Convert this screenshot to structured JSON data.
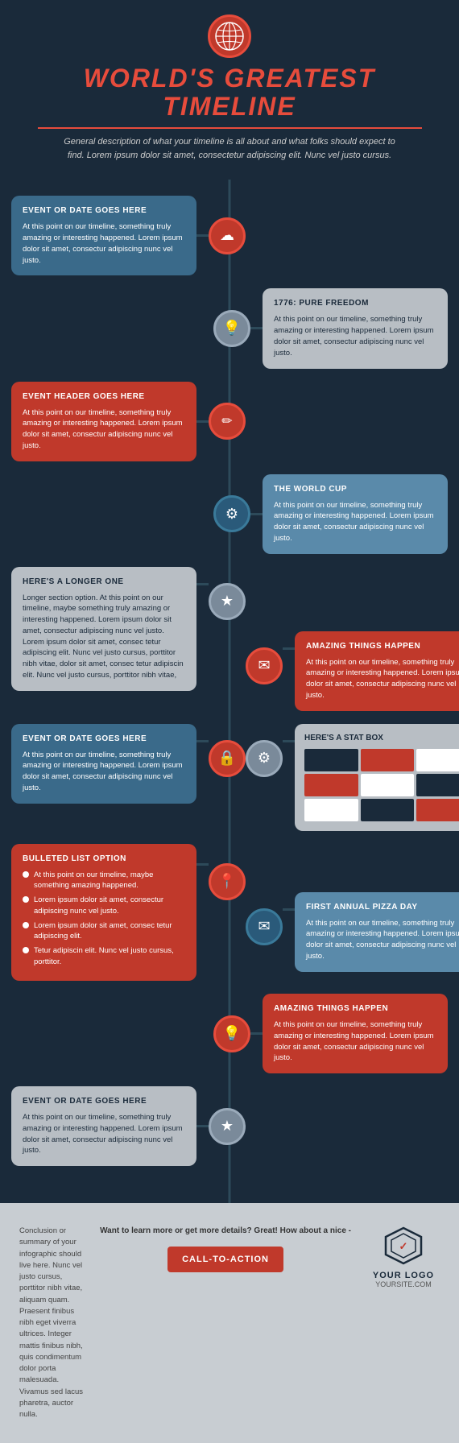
{
  "header": {
    "title": "WORLD'S GREATEST TIMELINE",
    "subtitle": "General description of what your timeline is all about and what folks should expect to find. Lorem ipsum dolor sit amet, consectetur adipiscing elit. Nunc vel justo cursus."
  },
  "timeline": {
    "events": [
      {
        "side": "left",
        "style": "blue",
        "icon": "☁",
        "icon_style": "red",
        "title": "EVENT OR DATE GOES HERE",
        "body": "At this point on our timeline, something truly amazing or interesting happened. Lorem ipsum dolor sit amet, consectur adipiscing nunc vel justo."
      },
      {
        "side": "right",
        "style": "gray",
        "icon": "💡",
        "icon_style": "gray",
        "title": "1776: PURE FREEDOM",
        "body": "At this point on our timeline, something truly amazing or interesting happened. Lorem ipsum dolor sit amet, consectur adipiscing nunc vel justo."
      },
      {
        "side": "left",
        "style": "red",
        "icon": "✏",
        "icon_style": "red",
        "title": "EVENT HEADER GOES HERE",
        "body": "At this point on our timeline, something truly amazing or interesting happened. Lorem ipsum dolor sit amet, consectur adipiscing nunc vel justo."
      },
      {
        "side": "right",
        "style": "light-blue",
        "icon": "⚙",
        "icon_style": "blue",
        "title": "THE WORLD CUP",
        "body": "At this point on our timeline, something truly amazing or interesting happened. Lorem ipsum dolor sit amet, consectur adipiscing nunc vel justo."
      },
      {
        "side": "left",
        "style": "gray",
        "icon": "★",
        "icon_style": "gray",
        "title": "HERE'S A LONGER ONE",
        "body": "Longer section option. At this point on our timeline, maybe something truly amazing or interesting happened. Lorem ipsum dolor sit amet, consectur adipiscing nunc vel justo. Lorem ipsum dolor sit amet, consec tetur adipiscing elit. Nunc vel justo cursus, porttitor nibh vitae, dolor sit amet, consec tetur adipiscin elit. Nunc vel justo cursus, porttitor nibh vitae,"
      },
      {
        "side": "right",
        "style": "red",
        "icon": "✉",
        "icon_style": "red",
        "title": "AMAZING THINGS HAPPEN",
        "body": "At this point on our timeline, something truly amazing or interesting happened. Lorem ipsum dolor sit amet, consectur adipiscing nunc vel justo."
      },
      {
        "side": "left",
        "style": "blue",
        "icon": "🔒",
        "icon_style": "red",
        "title": "EVENT OR DATE GOES HERE",
        "body": "At this point on our timeline, something truly amazing or interesting happened. Lorem ipsum dolor sit amet, consectur adipiscing nunc vel justo."
      },
      {
        "side": "right",
        "style": "stat",
        "icon": "⚙",
        "icon_style": "gray",
        "title": "HERE'S A STAT BOX"
      },
      {
        "side": "left",
        "style": "red",
        "icon": "📍",
        "icon_style": "red",
        "title": "BULLETED LIST OPTION",
        "bullets": [
          "At this point on our timeline, maybe something amazing happened.",
          "Lorem ipsum dolor sit amet, consectur adipiscing nunc vel justo.",
          "Lorem ipsum dolor sit amet, consec tetur adipiscing elit.",
          "Tetur adipiscin elit. Nunc vel justo cursus, porttitor."
        ]
      },
      {
        "side": "right",
        "style": "light-blue",
        "icon": "✉",
        "icon_style": "blue",
        "title": "FIRST ANNUAL PIZZA DAY",
        "body": "At this point on our timeline, something truly amazing or interesting happened. Lorem ipsum dolor sit amet, consectur adipiscing nunc vel justo."
      },
      {
        "side": "right",
        "style": "red",
        "icon": "💡",
        "icon_style": "red",
        "title": "AMAZING THINGS HAPPEN",
        "body": "At this point on our timeline, something truly amazing or interesting happened. Lorem ipsum dolor sit amet, consectur adipiscing nunc vel justo."
      },
      {
        "side": "left",
        "style": "gray",
        "icon": "★",
        "icon_style": "gray",
        "title": "EVENT OR DATE GOES HERE",
        "body": "At this point on our timeline, something truly amazing or interesting happened. Lorem ipsum dolor sit amet, consectur adipiscing nunc vel justo."
      }
    ]
  },
  "footer": {
    "conclusion": "Conclusion or summary of your infographic should live here. Nunc vel justo cursus, porttitor nibh vitae, aliquam quam. Praesent finibus nibh eget viverra ultrices. Integer mattis finibus nibh, quis condimentum dolor porta malesuada. Vivamus sed lacus pharetra, auctor nulla.",
    "cta_prompt": "Want to learn more or get more details? Great! How about a nice -",
    "cta_button": "CALL-TO-ACTION",
    "logo_name": "YOUR LOGO",
    "logo_url": "YOURSITE.COM"
  }
}
